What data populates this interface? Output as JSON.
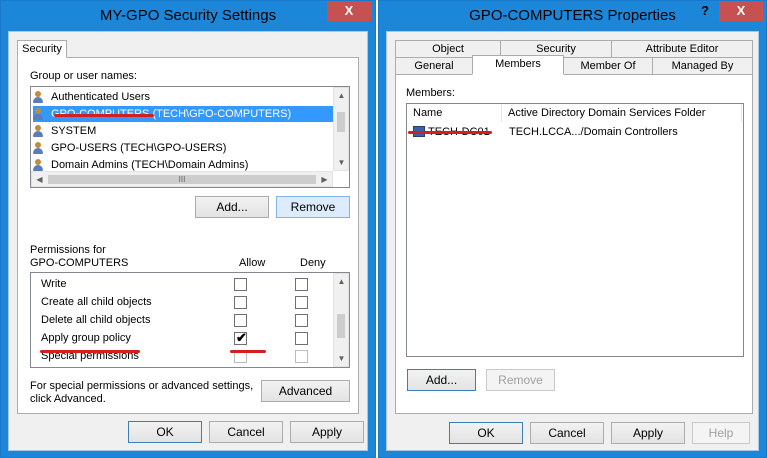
{
  "left_dialog": {
    "title": "MY-GPO Security Settings",
    "close_glyph": "X",
    "tab_security": "Security",
    "group_label": "Group or user names:",
    "principals": [
      "Authenticated Users",
      "GPO-COMPUTERS (TECH\\GPO-COMPUTERS)",
      "SYSTEM",
      "GPO-USERS (TECH\\GPO-USERS)",
      "Domain Admins (TECH\\Domain Admins)"
    ],
    "hscroll_thumb": "III",
    "add_label": "Add...",
    "remove_label": "Remove",
    "perm_for_label": "Permissions for",
    "perm_for_name": "GPO-COMPUTERS",
    "allow_label": "Allow",
    "deny_label": "Deny",
    "permissions": [
      {
        "name": "Write",
        "allow": false,
        "deny": false
      },
      {
        "name": "Create all child objects",
        "allow": false,
        "deny": false
      },
      {
        "name": "Delete all child objects",
        "allow": false,
        "deny": false
      },
      {
        "name": "Apply group policy",
        "allow": true,
        "deny": false
      },
      {
        "name": "Special permissions",
        "allow": false,
        "deny": false
      }
    ],
    "special_note_line1": "For special permissions or advanced settings,",
    "special_note_line2": "click Advanced.",
    "advanced_label": "Advanced",
    "ok_label": "OK",
    "cancel_label": "Cancel",
    "apply_label": "Apply"
  },
  "right_dialog": {
    "title": "GPO-COMPUTERS Properties",
    "help_glyph": "?",
    "close_glyph": "X",
    "tabs_row1": [
      "Object",
      "Security",
      "Attribute Editor"
    ],
    "tabs_row2": [
      "General",
      "Members",
      "Member Of",
      "Managed By"
    ],
    "active_tab": "Members",
    "members_label": "Members:",
    "columns": [
      "Name",
      "Active Directory Domain Services Folder"
    ],
    "members": [
      {
        "name": "TECH-DC01",
        "folder": "TECH.LCCA.../Domain Controllers"
      }
    ],
    "add_label": "Add...",
    "remove_label": "Remove",
    "ok_label": "OK",
    "cancel_label": "Cancel",
    "apply_label": "Apply",
    "help_label": "Help"
  },
  "colors": {
    "title_bar": "#1c87d9",
    "selection": "#3399ff",
    "annotation": "#d21f1f",
    "close_button": "#c75050"
  }
}
